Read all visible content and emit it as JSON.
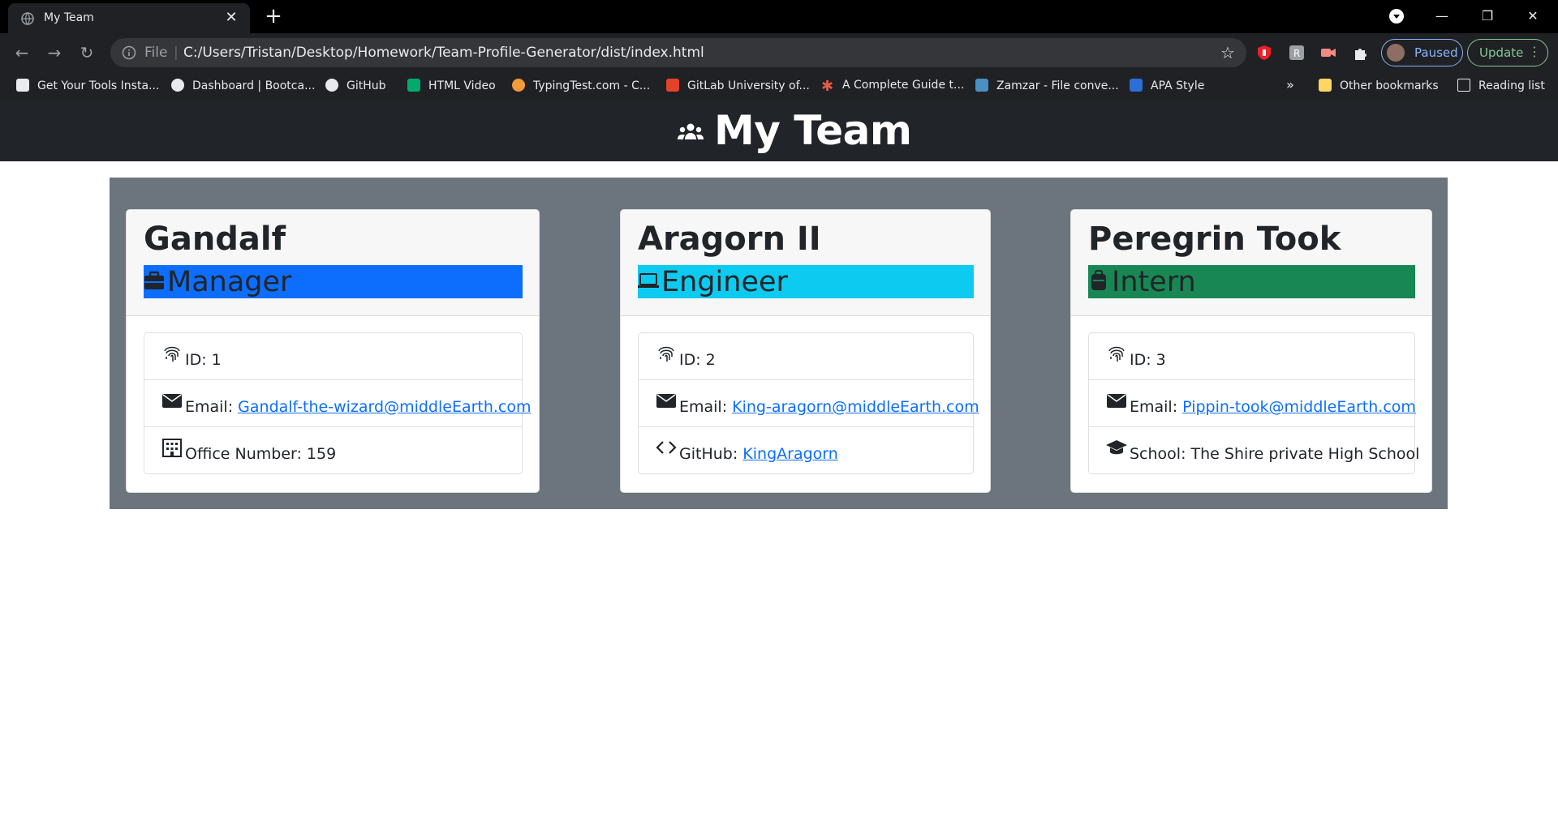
{
  "browser": {
    "tab_title": "My Team",
    "address_scheme": "File",
    "address_url": "C:/Users/Tristan/Desktop/Homework/Team-Profile-Generator/dist/index.html",
    "profile_status": "Paused",
    "update_label": "Update",
    "bookmarks": [
      {
        "label": "Get Your Tools Insta...",
        "icon": "book-icon"
      },
      {
        "label": "Dashboard | Bootca...",
        "icon": "globe-icon"
      },
      {
        "label": "GitHub",
        "icon": "github-icon"
      },
      {
        "label": "HTML Video",
        "icon": "w3-icon"
      },
      {
        "label": "TypingTest.com - C...",
        "icon": "typingtest-icon"
      },
      {
        "label": "GitLab University of...",
        "icon": "gitlab-icon"
      },
      {
        "label": "A Complete Guide t...",
        "icon": "asterisk-icon"
      },
      {
        "label": "Zamzar - File conve...",
        "icon": "zamzar-icon"
      },
      {
        "label": "APA Style",
        "icon": "apa-icon"
      }
    ],
    "more_bookmarks": "»",
    "other_bookmarks": "Other bookmarks",
    "reading_list": "Reading list"
  },
  "page": {
    "title": "My Team"
  },
  "team": [
    {
      "name": "Gandalf",
      "role": "Manager",
      "id_text": "ID: 1",
      "email_label": "Email: ",
      "email": "Gandalf-the-wizard@middleEarth.com",
      "extra_label": "Office Number: 159",
      "extra_link": ""
    },
    {
      "name": "Aragorn II",
      "role": "Engineer",
      "id_text": "ID: 2",
      "email_label": "Email: ",
      "email": "King-aragorn@middleEarth.com",
      "extra_label": "GitHub: ",
      "extra_link": "KingAragorn"
    },
    {
      "name": "Peregrin Took",
      "role": "Intern",
      "id_text": "ID: 3",
      "email_label": "Email: ",
      "email": "Pippin-took@middleEarth.com",
      "extra_label": "School: The Shire private High School",
      "extra_link": ""
    }
  ],
  "colors": {
    "manager": "#0d6efd",
    "engineer": "#0dcaf0",
    "intern": "#198754",
    "header_bg": "#212529",
    "panel_bg": "#6c757d",
    "link": "#0d6efd"
  }
}
